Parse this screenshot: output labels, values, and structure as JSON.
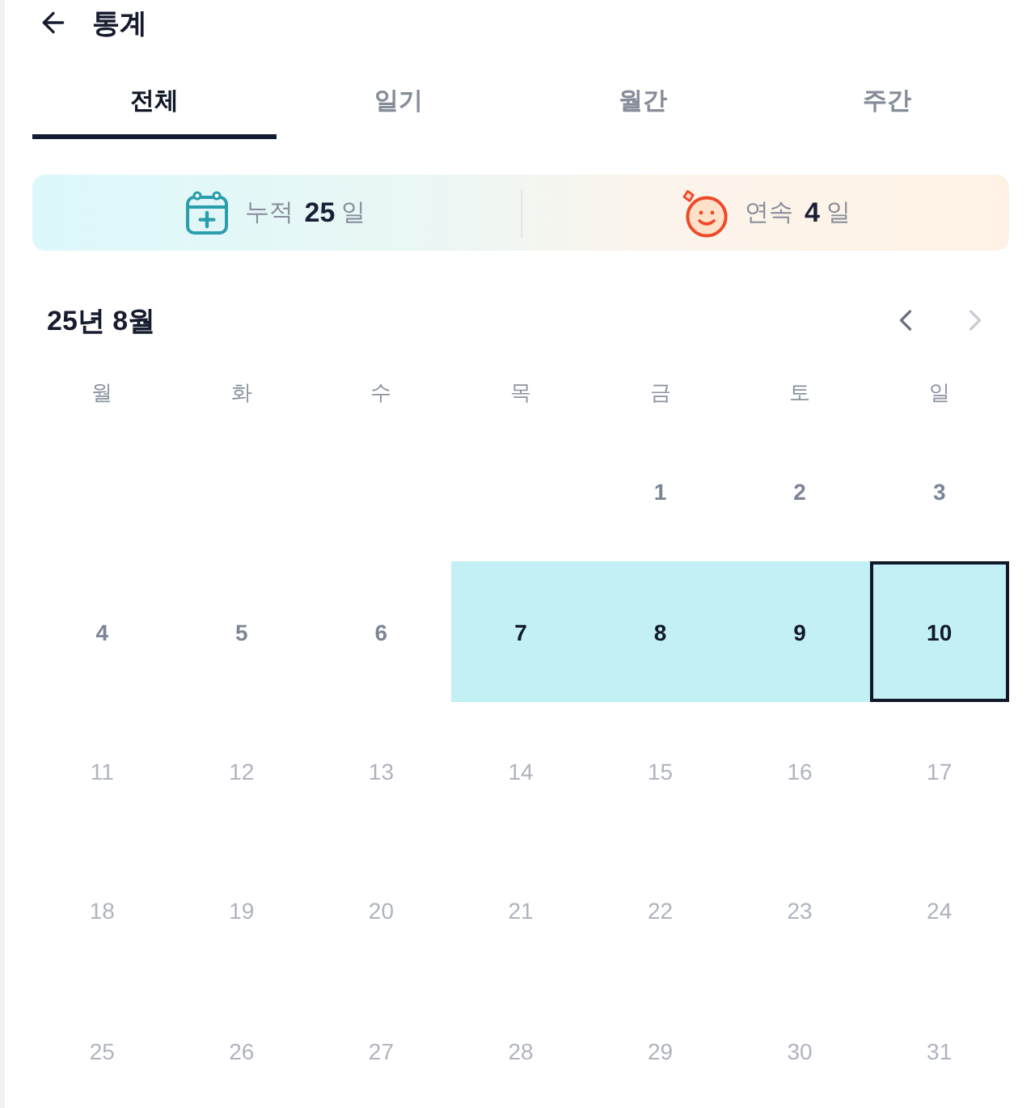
{
  "header": {
    "title": "통계"
  },
  "tabs": [
    {
      "label": "전체",
      "selected": true
    },
    {
      "label": "일기",
      "selected": false
    },
    {
      "label": "월간",
      "selected": false
    },
    {
      "label": "주간",
      "selected": false
    }
  ],
  "stats": [
    {
      "kind": "total",
      "label": "누적",
      "value": "25",
      "unit": "일"
    },
    {
      "kind": "streak",
      "label": "연속",
      "value": "4",
      "unit": "일"
    }
  ],
  "calendar": {
    "title": "25년 8월",
    "nav": [
      {
        "kind": "prev",
        "disabled": false
      },
      {
        "kind": "next",
        "disabled": true
      }
    ],
    "weekdays": [
      "월",
      "화",
      "수",
      "목",
      "금",
      "토",
      "일"
    ],
    "weeks": [
      {
        "days": [
          {
            "label": "1",
            "recorded": false,
            "today": false,
            "disabled": false
          },
          {
            "label": "2",
            "recorded": false,
            "today": false,
            "disabled": false
          },
          {
            "label": "3",
            "recorded": false,
            "today": false,
            "disabled": false
          }
        ]
      },
      {
        "days": [
          {
            "label": "4",
            "recorded": false,
            "today": false,
            "disabled": false
          },
          {
            "label": "5",
            "recorded": false,
            "today": false,
            "disabled": false
          },
          {
            "label": "6",
            "recorded": false,
            "today": false,
            "disabled": false
          },
          {
            "label": "7",
            "recorded": true,
            "today": false,
            "disabled": false
          },
          {
            "label": "8",
            "recorded": true,
            "today": false,
            "disabled": false
          },
          {
            "label": "9",
            "recorded": true,
            "today": false,
            "disabled": false
          },
          {
            "label": "10",
            "recorded": true,
            "today": true,
            "disabled": false
          }
        ]
      },
      {
        "days": [
          {
            "label": "11",
            "recorded": false,
            "today": false,
            "disabled": true
          },
          {
            "label": "12",
            "recorded": false,
            "today": false,
            "disabled": true
          },
          {
            "label": "13",
            "recorded": false,
            "today": false,
            "disabled": true
          },
          {
            "label": "14",
            "recorded": false,
            "today": false,
            "disabled": true
          },
          {
            "label": "15",
            "recorded": false,
            "today": false,
            "disabled": true
          },
          {
            "label": "16",
            "recorded": false,
            "today": false,
            "disabled": true
          },
          {
            "label": "17",
            "recorded": false,
            "today": false,
            "disabled": true
          }
        ]
      },
      {
        "days": [
          {
            "label": "18",
            "recorded": false,
            "today": false,
            "disabled": true
          },
          {
            "label": "19",
            "recorded": false,
            "today": false,
            "disabled": true
          },
          {
            "label": "20",
            "recorded": false,
            "today": false,
            "disabled": true
          },
          {
            "label": "21",
            "recorded": false,
            "today": false,
            "disabled": true
          },
          {
            "label": "22",
            "recorded": false,
            "today": false,
            "disabled": true
          },
          {
            "label": "23",
            "recorded": false,
            "today": false,
            "disabled": true
          },
          {
            "label": "24",
            "recorded": false,
            "today": false,
            "disabled": true
          }
        ]
      },
      {
        "days": [
          {
            "label": "25",
            "recorded": false,
            "today": false,
            "disabled": true
          },
          {
            "label": "26",
            "recorded": false,
            "today": false,
            "disabled": true
          },
          {
            "label": "27",
            "recorded": false,
            "today": false,
            "disabled": true
          },
          {
            "label": "28",
            "recorded": false,
            "today": false,
            "disabled": true
          },
          {
            "label": "29",
            "recorded": false,
            "today": false,
            "disabled": true
          },
          {
            "label": "30",
            "recorded": false,
            "today": false,
            "disabled": true
          },
          {
            "label": "31",
            "recorded": false,
            "today": false,
            "disabled": true
          }
        ]
      }
    ]
  }
}
